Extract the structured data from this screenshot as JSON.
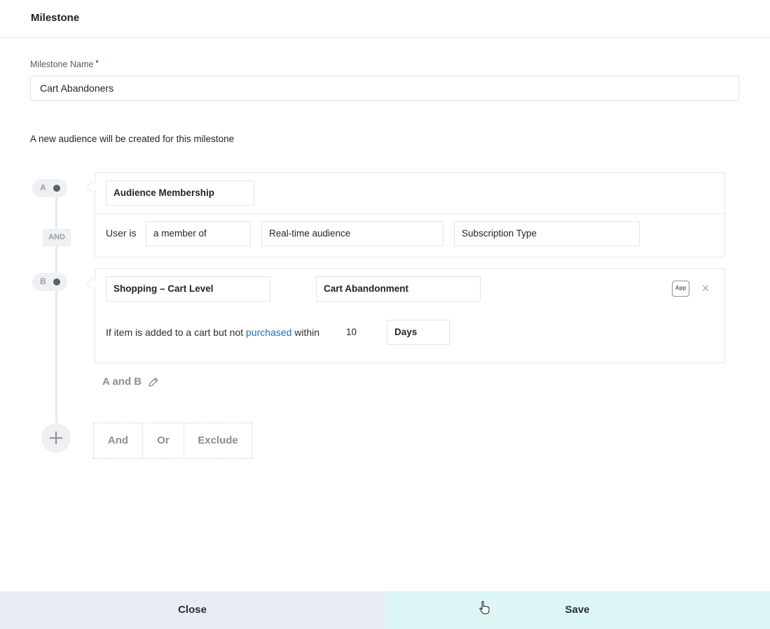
{
  "header": {
    "title": "Milestone"
  },
  "milestone_name": {
    "label": "Milestone Name",
    "required_mark": "•",
    "value": "Cart Abandoners"
  },
  "info_text": "A new audience will be created for this milestone",
  "nodes": {
    "a_label": "A",
    "b_label": "B",
    "and_badge": "AND"
  },
  "condition_a": {
    "type": "Audience Membership",
    "prefix": "User is",
    "relation": "a member of",
    "audience_kind": "Real-time audience",
    "audience_name": "Subscription Type"
  },
  "condition_b": {
    "category": "Shopping – Cart Level",
    "event": "Cart Abandonment",
    "app_badge": "App",
    "remove_glyph": "×",
    "rule_prefix": "If item is added to a cart but not",
    "rule_link": "purchased",
    "rule_suffix": "within",
    "duration_value": "10",
    "duration_unit": "Days"
  },
  "expression": "A and B",
  "operators": {
    "and": "And",
    "or": "Or",
    "exclude": "Exclude"
  },
  "footer": {
    "close_label": "Close",
    "save_label": "Save"
  },
  "colors": {
    "accent_link": "#1f6fb2",
    "save_bg": "#ddf7f6",
    "close_bg": "#e9ecf3",
    "required": "#c0392b"
  },
  "icons": [
    "pencil-icon",
    "plus-icon",
    "close-icon",
    "app-icon"
  ]
}
